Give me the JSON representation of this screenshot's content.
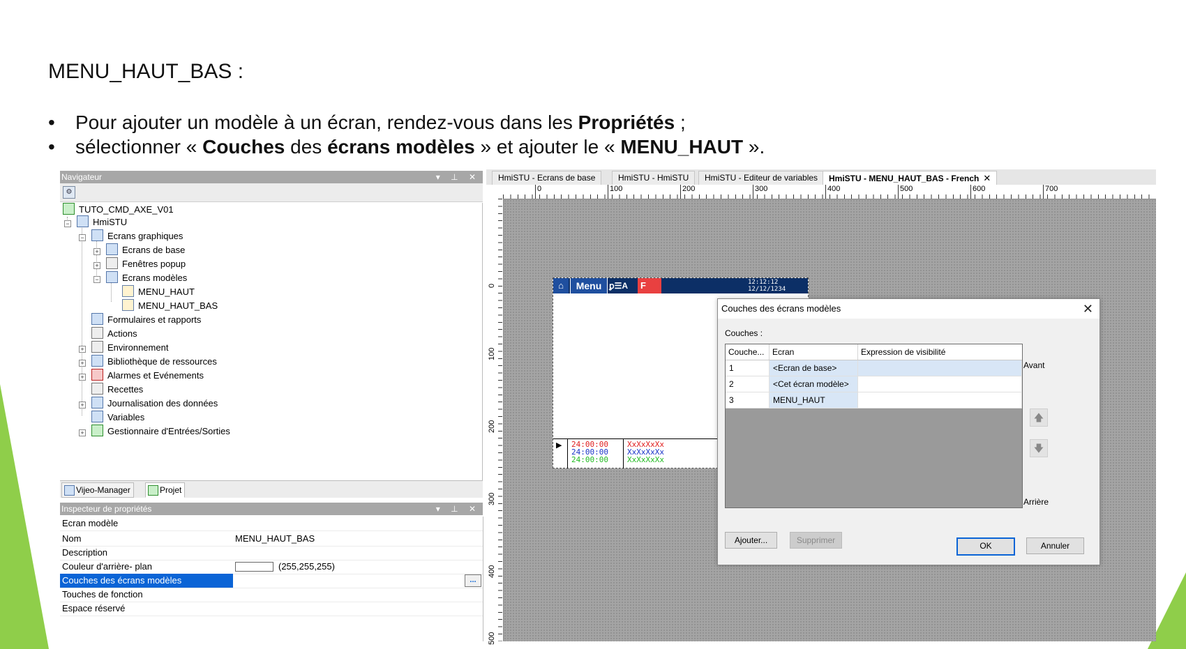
{
  "slide": {
    "title": "MENU_HAUT_BAS :",
    "bullet1": {
      "pre": "Pour ajouter un modèle à un écran, rendez-vous dans les ",
      "bold": "Propriétés",
      "post": " ;"
    },
    "bullet2": {
      "pre": "sélectionner « ",
      "bold1": "Couches",
      "mid1": " des ",
      "bold2": "écrans modèles",
      "mid2": " » et ajouter le « ",
      "bold3": "MENU_HAUT",
      "post": " »."
    },
    "accent_color": "#8fce4a"
  },
  "navigator": {
    "title": "Navigateur",
    "header_icons": "▾ ⊥ ✕",
    "toolbar_icon": "properties-icon",
    "tree": [
      {
        "label": "TUTO_CMD_AXE_V01",
        "icon": "project-icon"
      },
      {
        "label": "HmiSTU",
        "icon": "hmi-station-icon",
        "expander": "−"
      },
      {
        "label": "Ecrans graphiques",
        "icon": "screens-icon",
        "expander": "−"
      },
      {
        "label": "Ecrans de base",
        "icon": "base-screens-icon",
        "expander": "+"
      },
      {
        "label": "Fenêtres popup",
        "icon": "popup-windows-icon",
        "expander": "+"
      },
      {
        "label": "Ecrans modèles",
        "icon": "template-screens-icon",
        "expander": "−"
      },
      {
        "label": "MENU_HAUT",
        "icon": "template-screen-icon"
      },
      {
        "label": "MENU_HAUT_BAS",
        "icon": "template-screen-icon"
      },
      {
        "label": "Formulaires et rapports",
        "icon": "forms-icon"
      },
      {
        "label": "Actions",
        "icon": "actions-icon"
      },
      {
        "label": "Environnement",
        "icon": "environment-icon",
        "expander": "+"
      },
      {
        "label": "Bibliothèque de ressources",
        "icon": "resource-library-icon",
        "expander": "+"
      },
      {
        "label": "Alarmes et Evénements",
        "icon": "alarms-icon",
        "expander": "+"
      },
      {
        "label": "Recettes",
        "icon": "recipes-icon"
      },
      {
        "label": "Journalisation des données",
        "icon": "data-logging-icon",
        "expander": "+"
      },
      {
        "label": "Variables",
        "icon": "variables-icon"
      },
      {
        "label": "Gestionnaire d'Entrées/Sorties",
        "icon": "io-manager-icon",
        "expander": "+"
      }
    ],
    "tabs": [
      {
        "label": "Vijeo-Manager",
        "active": false
      },
      {
        "label": "Projet",
        "active": true
      }
    ]
  },
  "inspector": {
    "title": "Inspecteur de propriétés",
    "header_icons": "▾ ⊥ ✕",
    "object_type": "Ecran modèle",
    "rows": [
      {
        "name": "Nom",
        "value": "MENU_HAUT_BAS"
      },
      {
        "name": "Description",
        "value": ""
      },
      {
        "name": "Couleur d'arrière- plan",
        "value": "(255,255,255)",
        "swatch": "#ffffff"
      },
      {
        "name": "Couches des écrans modèles",
        "value": "",
        "selected": true,
        "button": "..."
      },
      {
        "name": "Touches de fonction",
        "value": ""
      },
      {
        "name": "Espace réservé",
        "value": ""
      }
    ],
    "selection_color": "#0a64d6"
  },
  "editor": {
    "tabs": [
      {
        "label": "HmiSTU - Ecrans de base",
        "active": false
      },
      {
        "label": "HmiSTU - HmiSTU",
        "active": false
      },
      {
        "label": "HmiSTU - Editeur de variables",
        "active": false
      },
      {
        "label": "HmiSTU - MENU_HAUT_BAS - French",
        "active": true,
        "close": "✕"
      }
    ],
    "ruler_h": [
      "0",
      "100",
      "200",
      "300",
      "400",
      "500",
      "600",
      "700"
    ],
    "ruler_v": [
      "0",
      "100",
      "200",
      "300",
      "400",
      "500"
    ],
    "preview": {
      "home_icon": "home-icon",
      "menu_label": "Menu",
      "icons_text": "ꝑ☰A",
      "alarm_text": "F I",
      "clock_text": "12:12:12\n12/12/1234",
      "alarm_rows": [
        {
          "time": "24:00:00",
          "msg": "XxXxXxXx",
          "color": "#e02020"
        },
        {
          "time": "24:00:00",
          "msg": "XxXxXxXx",
          "color": "#1a35c8"
        },
        {
          "time": "24:00:00",
          "msg": "XxXxXxXx",
          "color": "#22bb22"
        }
      ],
      "marker": "▶",
      "bar_color": "#0c2f66"
    }
  },
  "dialog": {
    "title": "Couches des écrans modèles",
    "close": "✕",
    "layers_label": "Couches :",
    "columns": [
      "Couche...",
      "Ecran",
      "Expression de visibilité"
    ],
    "rows": [
      {
        "layer": "1",
        "screen": "<Ecran de base>",
        "expr": ""
      },
      {
        "layer": "2",
        "screen": "<Cet écran modèle>",
        "expr": ""
      },
      {
        "layer": "3",
        "screen": "MENU_HAUT",
        "expr": ""
      }
    ],
    "front_label": "Avant",
    "back_label": "Arrière",
    "up_icon": "arrow-up-icon",
    "down_icon": "arrow-down-icon",
    "add_button": "Ajouter...",
    "delete_button": "Supprimer",
    "ok_button": "OK",
    "cancel_button": "Annuler"
  }
}
